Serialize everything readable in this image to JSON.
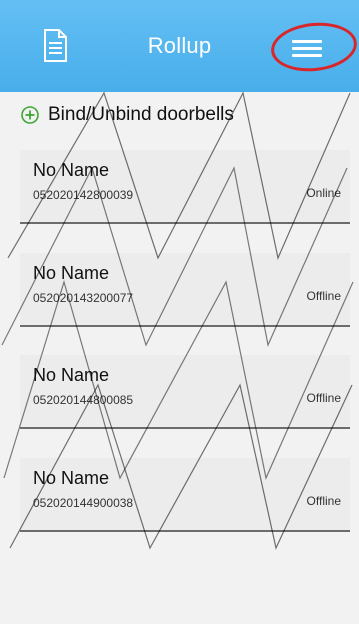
{
  "header": {
    "title": "Rollup",
    "left_icon": "document-icon",
    "right_icon": "hamburger-menu-icon",
    "background_color": "#52b5ee"
  },
  "bind_action": {
    "label": "Bind/Unbind doorbells",
    "icon": "plus-circle-icon",
    "icon_color": "#3fa535"
  },
  "devices": [
    {
      "name": "No Name",
      "serial": "052020142800039",
      "status": "Online"
    },
    {
      "name": "No Name",
      "serial": "052020143200077",
      "status": "Offline"
    },
    {
      "name": "No Name",
      "serial": "052020144800085",
      "status": "Offline"
    },
    {
      "name": "No Name",
      "serial": "052020144900038",
      "status": "Offline"
    }
  ],
  "annotation_color": "#d9262b"
}
